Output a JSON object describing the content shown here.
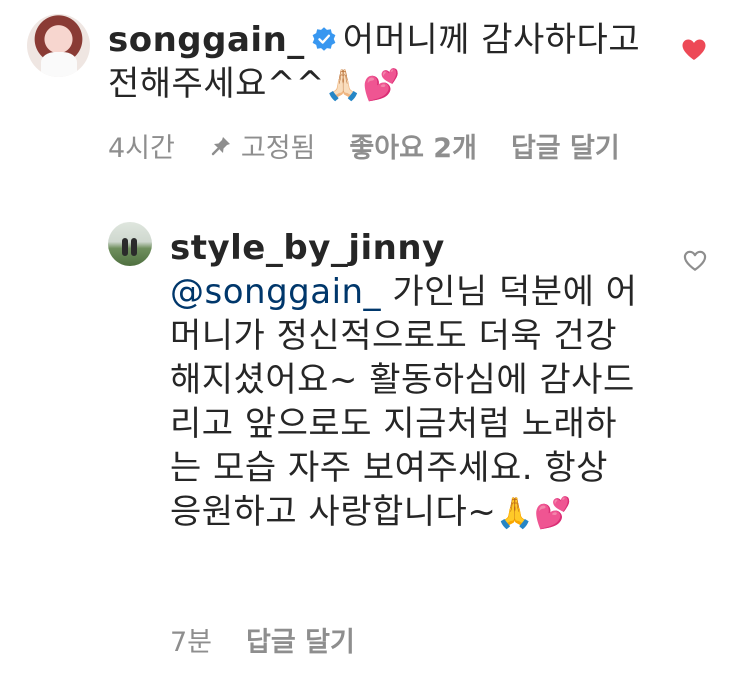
{
  "comments": [
    {
      "username": "songgain_",
      "text": "어머니께 감사하다고 전해주세요^^",
      "emoji": [
        "folded-hands",
        "two-hearts"
      ],
      "time": "4시간",
      "pinned_label": "고정됨",
      "likes_label": "좋아요 2개",
      "reply_label": "답글 달기",
      "liked": true,
      "verified": true
    },
    {
      "username": "style_by_jinny",
      "mention": "@songgain_",
      "text": "가인님 덕분에 어머니가 정신적으로도 더욱 건강해지셨어요~ 활동하심에 감사드리고 앞으로도 지금처럼 노래하는 모습 자주 보여주세요. 항상 응원하고 사랑합니다~",
      "emoji": [
        "folded-hands",
        "two-hearts"
      ],
      "time": "7분",
      "reply_label": "답글 달기",
      "liked": false
    }
  ],
  "colors": {
    "liked_heart": "#ed4956",
    "meta_gray": "#8e8e8e",
    "mention_blue": "#00376b",
    "verified_blue": "#3897f0"
  }
}
